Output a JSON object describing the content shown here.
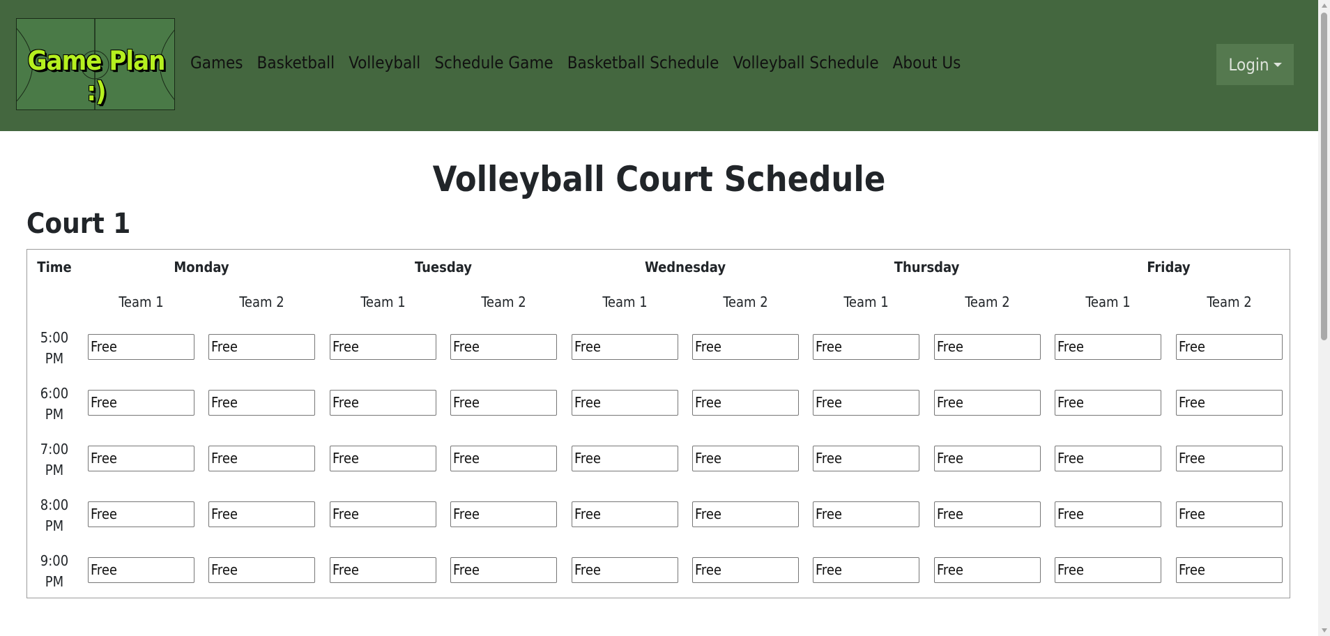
{
  "brand": {
    "logo_text": "Game Plan :)"
  },
  "nav": {
    "links": [
      "Games",
      "Basketball",
      "Volleyball",
      "Schedule Game",
      "Basketball Schedule",
      "Volleyball Schedule",
      "About Us"
    ],
    "login_label": "Login"
  },
  "page": {
    "title": "Volleyball Court Schedule"
  },
  "court": {
    "title": "Court 1",
    "time_header": "Time",
    "days": [
      "Monday",
      "Tuesday",
      "Wednesday",
      "Thursday",
      "Friday"
    ],
    "team_labels": [
      "Team 1",
      "Team 2"
    ],
    "times": [
      {
        "hour": "5:00",
        "period": "PM"
      },
      {
        "hour": "6:00",
        "period": "PM"
      },
      {
        "hour": "7:00",
        "period": "PM"
      },
      {
        "hour": "8:00",
        "period": "PM"
      },
      {
        "hour": "9:00",
        "period": "PM"
      }
    ],
    "slot_value": "Free"
  },
  "colors": {
    "navbar": "#44673f",
    "logo_text": "#b5f01f",
    "login_button": "#55794f"
  }
}
